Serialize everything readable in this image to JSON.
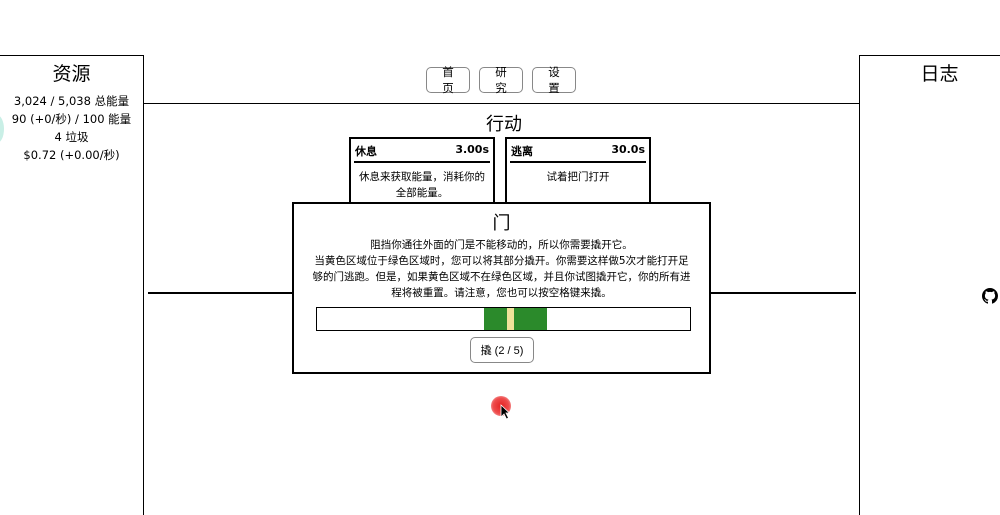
{
  "resources": {
    "title": "资源",
    "items": [
      "3,024 / 5,038 总能量",
      "90 (+0/秒) / 100 能量",
      "4 垃圾",
      "$0.72 (+0.00/秒)"
    ]
  },
  "log": {
    "title": "日志"
  },
  "nav": {
    "home": "首页",
    "research": "研究",
    "settings": "设置"
  },
  "actions": {
    "title": "行动",
    "cards": [
      {
        "name": "休息",
        "time": "3.00s",
        "desc": "休息来获取能量，消耗你的全部能量。"
      },
      {
        "name": "逃离",
        "time": "30.0s",
        "desc": "试着把门打开"
      }
    ]
  },
  "modal": {
    "title": "门",
    "desc_lines": [
      "阻挡你通往外面的门是不能移动的，所以你需要撬开它。",
      "当黄色区域位于绿色区域时，您可以将其部分撬开。你需要这样做5次才能打开足够的门逃跑。但是，如果黄色区域不在绿色区域，并且你试图撬开它，你的所有进程将被重置。请注意，您也可以按空格键来撬。"
    ],
    "pry_button": "撬 (2 / 5)",
    "pry_progress": {
      "done": 2,
      "total": 5
    }
  },
  "colors": {
    "green_zone": "#2b8a2b",
    "yellow_marker": "#efe39a",
    "cursor_highlight": "#e52222"
  },
  "icons": {
    "github": "github-icon",
    "cursor": "cursor-icon"
  }
}
